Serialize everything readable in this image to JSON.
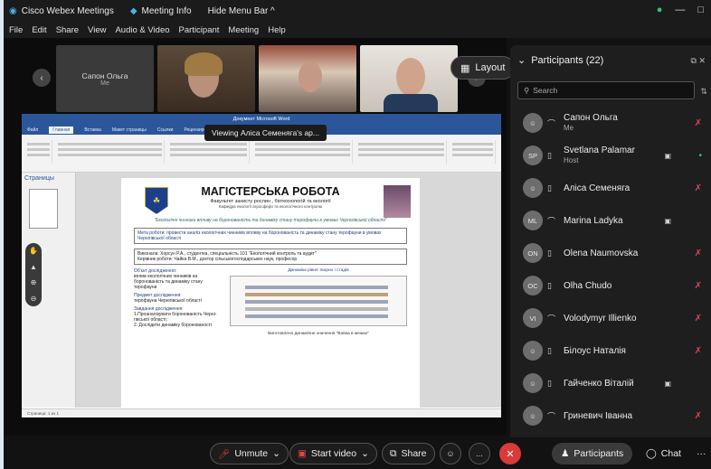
{
  "app": {
    "title": "Cisco Webex Meetings",
    "meeting_info": "Meeting Info",
    "hide_menu": "Hide Menu Bar ^"
  },
  "menu": [
    "File",
    "Edit",
    "Share",
    "View",
    "Audio & Video",
    "Participant",
    "Meeting",
    "Help"
  ],
  "video": {
    "tiles": [
      {
        "name": "Сапон Ольга",
        "sub": "Me"
      }
    ],
    "layout_label": "Layout"
  },
  "share": {
    "viewing_label": "Viewing Аліса Семеняга's ар...",
    "word_title": "Документ Microsoft Word",
    "tabs": [
      "Файл",
      "Главная",
      "Вставка",
      "Макет страницы",
      "Ссылки",
      "Рецензирование"
    ],
    "nav_label": "Страницы",
    "doc": {
      "title": "МАГІСТЕРСЬКА РОБОТА",
      "faculty": "Факультет захисту рослин , біотехнологій та екології",
      "department": "Кафедра екології агросфери та екологічного контролю",
      "theme": "\"Екологічні чинники впливу на боронованість та динаміку стану терофауни в умовах Чернігівської області\"",
      "goal": "Мета роботи: провести аналіз екологічних чинників впливу на боронованість та динаміку стану терофауни в умовах Чернігівської області",
      "author": "Виконала: Хорсун Р.А., студентка, спеціальність 101 \"Екологічний контроль та аудит\"",
      "supervisor": "Керівник роботи: Чайка В.М., доктор сільськогосподарських наук, професор",
      "object_h": "Об'єкт дослідження:",
      "object": "вплив екологічних чинників на боронованість та динаміку стану терофауни",
      "subject_h": "Предмет дослідження:",
      "subject": "терофауна Чернігівської області",
      "tasks_h": "Завдання дослідження:",
      "task1": "1.Проаналізувати боронованість Черні- гівської області;",
      "task2": "2. Дослідити динаміку боронованості",
      "chart_title": "Динаміка рівня творно і стадів",
      "chart_sub": "Виготовлено динамічне значення \"Вовка в межах\""
    },
    "status": "Страница: 1 из 1"
  },
  "participants": {
    "header": "Participants (22)",
    "search_placeholder": "Search",
    "list": [
      {
        "initials": "",
        "name": "Сапон Ольга",
        "role": "Me",
        "mic": "muted",
        "cam": false
      },
      {
        "initials": "SP",
        "name": "Svetlana Palamar",
        "role": "Host",
        "mic": "on",
        "cam": true
      },
      {
        "initials": "",
        "name": "Аліса Семеняга",
        "role": "",
        "mic": "muted",
        "cam": false
      },
      {
        "initials": "ML",
        "name": "Marina Ladyka",
        "role": "",
        "mic": "none",
        "cam": true
      },
      {
        "initials": "ON",
        "name": "Olena Naumovska",
        "role": "",
        "mic": "muted",
        "cam": false
      },
      {
        "initials": "OC",
        "name": "Olha Chudo",
        "role": "",
        "mic": "muted",
        "cam": false
      },
      {
        "initials": "VI",
        "name": "Volodymyr Illienko",
        "role": "",
        "mic": "muted",
        "cam": false
      },
      {
        "initials": "",
        "name": "Білоус Наталія",
        "role": "",
        "mic": "muted",
        "cam": false
      },
      {
        "initials": "",
        "name": "Гайченко Віталій",
        "role": "",
        "mic": "none",
        "cam": true
      },
      {
        "initials": "",
        "name": "Гриневич Іванна",
        "role": "",
        "mic": "muted",
        "cam": false
      }
    ]
  },
  "toolbar": {
    "unmute": "Unmute",
    "start_video": "Start video",
    "share": "Share",
    "participants": "Participants",
    "chat": "Chat",
    "more": "..."
  },
  "colors": {
    "muted": "#e04545",
    "unmuted": "#35c46a",
    "end_call": "#d93a3a",
    "word_blue": "#2b579a"
  }
}
